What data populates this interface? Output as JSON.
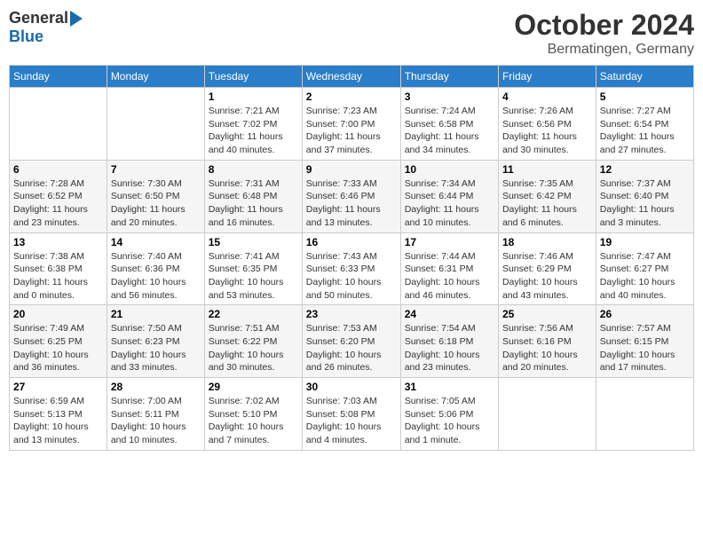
{
  "header": {
    "logo_general": "General",
    "logo_blue": "Blue",
    "month_title": "October 2024",
    "location": "Bermatingen, Germany"
  },
  "weekdays": [
    "Sunday",
    "Monday",
    "Tuesday",
    "Wednesday",
    "Thursday",
    "Friday",
    "Saturday"
  ],
  "weeks": [
    [
      {
        "day": "",
        "info": ""
      },
      {
        "day": "",
        "info": ""
      },
      {
        "day": "1",
        "info": "Sunrise: 7:21 AM\nSunset: 7:02 PM\nDaylight: 11 hours and 40 minutes."
      },
      {
        "day": "2",
        "info": "Sunrise: 7:23 AM\nSunset: 7:00 PM\nDaylight: 11 hours and 37 minutes."
      },
      {
        "day": "3",
        "info": "Sunrise: 7:24 AM\nSunset: 6:58 PM\nDaylight: 11 hours and 34 minutes."
      },
      {
        "day": "4",
        "info": "Sunrise: 7:26 AM\nSunset: 6:56 PM\nDaylight: 11 hours and 30 minutes."
      },
      {
        "day": "5",
        "info": "Sunrise: 7:27 AM\nSunset: 6:54 PM\nDaylight: 11 hours and 27 minutes."
      }
    ],
    [
      {
        "day": "6",
        "info": "Sunrise: 7:28 AM\nSunset: 6:52 PM\nDaylight: 11 hours and 23 minutes."
      },
      {
        "day": "7",
        "info": "Sunrise: 7:30 AM\nSunset: 6:50 PM\nDaylight: 11 hours and 20 minutes."
      },
      {
        "day": "8",
        "info": "Sunrise: 7:31 AM\nSunset: 6:48 PM\nDaylight: 11 hours and 16 minutes."
      },
      {
        "day": "9",
        "info": "Sunrise: 7:33 AM\nSunset: 6:46 PM\nDaylight: 11 hours and 13 minutes."
      },
      {
        "day": "10",
        "info": "Sunrise: 7:34 AM\nSunset: 6:44 PM\nDaylight: 11 hours and 10 minutes."
      },
      {
        "day": "11",
        "info": "Sunrise: 7:35 AM\nSunset: 6:42 PM\nDaylight: 11 hours and 6 minutes."
      },
      {
        "day": "12",
        "info": "Sunrise: 7:37 AM\nSunset: 6:40 PM\nDaylight: 11 hours and 3 minutes."
      }
    ],
    [
      {
        "day": "13",
        "info": "Sunrise: 7:38 AM\nSunset: 6:38 PM\nDaylight: 11 hours and 0 minutes."
      },
      {
        "day": "14",
        "info": "Sunrise: 7:40 AM\nSunset: 6:36 PM\nDaylight: 10 hours and 56 minutes."
      },
      {
        "day": "15",
        "info": "Sunrise: 7:41 AM\nSunset: 6:35 PM\nDaylight: 10 hours and 53 minutes."
      },
      {
        "day": "16",
        "info": "Sunrise: 7:43 AM\nSunset: 6:33 PM\nDaylight: 10 hours and 50 minutes."
      },
      {
        "day": "17",
        "info": "Sunrise: 7:44 AM\nSunset: 6:31 PM\nDaylight: 10 hours and 46 minutes."
      },
      {
        "day": "18",
        "info": "Sunrise: 7:46 AM\nSunset: 6:29 PM\nDaylight: 10 hours and 43 minutes."
      },
      {
        "day": "19",
        "info": "Sunrise: 7:47 AM\nSunset: 6:27 PM\nDaylight: 10 hours and 40 minutes."
      }
    ],
    [
      {
        "day": "20",
        "info": "Sunrise: 7:49 AM\nSunset: 6:25 PM\nDaylight: 10 hours and 36 minutes."
      },
      {
        "day": "21",
        "info": "Sunrise: 7:50 AM\nSunset: 6:23 PM\nDaylight: 10 hours and 33 minutes."
      },
      {
        "day": "22",
        "info": "Sunrise: 7:51 AM\nSunset: 6:22 PM\nDaylight: 10 hours and 30 minutes."
      },
      {
        "day": "23",
        "info": "Sunrise: 7:53 AM\nSunset: 6:20 PM\nDaylight: 10 hours and 26 minutes."
      },
      {
        "day": "24",
        "info": "Sunrise: 7:54 AM\nSunset: 6:18 PM\nDaylight: 10 hours and 23 minutes."
      },
      {
        "day": "25",
        "info": "Sunrise: 7:56 AM\nSunset: 6:16 PM\nDaylight: 10 hours and 20 minutes."
      },
      {
        "day": "26",
        "info": "Sunrise: 7:57 AM\nSunset: 6:15 PM\nDaylight: 10 hours and 17 minutes."
      }
    ],
    [
      {
        "day": "27",
        "info": "Sunrise: 6:59 AM\nSunset: 5:13 PM\nDaylight: 10 hours and 13 minutes."
      },
      {
        "day": "28",
        "info": "Sunrise: 7:00 AM\nSunset: 5:11 PM\nDaylight: 10 hours and 10 minutes."
      },
      {
        "day": "29",
        "info": "Sunrise: 7:02 AM\nSunset: 5:10 PM\nDaylight: 10 hours and 7 minutes."
      },
      {
        "day": "30",
        "info": "Sunrise: 7:03 AM\nSunset: 5:08 PM\nDaylight: 10 hours and 4 minutes."
      },
      {
        "day": "31",
        "info": "Sunrise: 7:05 AM\nSunset: 5:06 PM\nDaylight: 10 hours and 1 minute."
      },
      {
        "day": "",
        "info": ""
      },
      {
        "day": "",
        "info": ""
      }
    ]
  ]
}
